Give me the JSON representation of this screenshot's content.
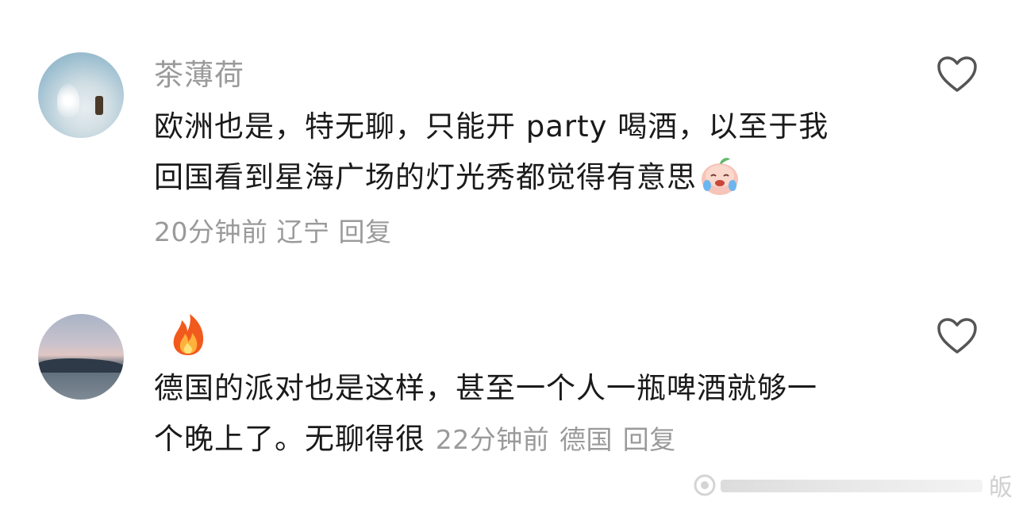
{
  "comments": [
    {
      "username": "茶薄荷",
      "text": "欧洲也是，特无聊，只能开 party 喝酒，以至于我回国看到星海广场的灯光秀都觉得有意思",
      "line1": "欧洲也是，特无聊，只能开 party 喝酒，以至于我",
      "line2": "回国看到星海广场的灯光秀都觉得有意思",
      "time": "20分钟前",
      "location": "辽宁",
      "reply_label": "回复",
      "emoji_icon": "laughing-crying-peach-icon"
    },
    {
      "username_icon": "fire-icon",
      "text": "德国的派对也是这样，甚至一个人一瓶啤酒就够一个晚上了。无聊得很",
      "line1": "德国的派对也是这样，甚至一个人一瓶啤酒就够一",
      "line2": "个晚上了。无聊得很",
      "time": "22分钟前",
      "location": "德国",
      "reply_label": "回复"
    }
  ],
  "watermark_text": "皈",
  "colors": {
    "text": "#1a1a1a",
    "muted": "#9a9a9a",
    "background": "#ffffff"
  }
}
